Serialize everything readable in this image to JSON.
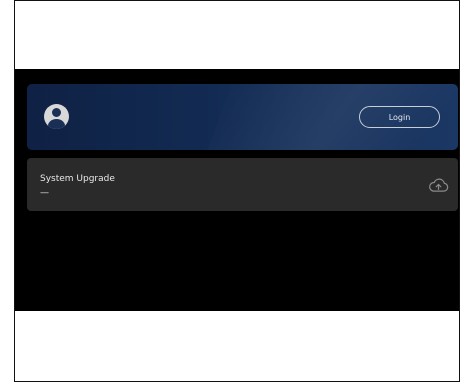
{
  "account": {
    "login_label": "Login"
  },
  "upgrade": {
    "title": "System Upgrade",
    "status": "—"
  },
  "icons": {
    "avatar": "user-avatar-icon",
    "upload": "cloud-upload-icon"
  },
  "colors": {
    "screen_bg": "#000000",
    "account_card": "#122a52",
    "upgrade_card": "#2a2a2a",
    "text": "#e8e8e8"
  }
}
